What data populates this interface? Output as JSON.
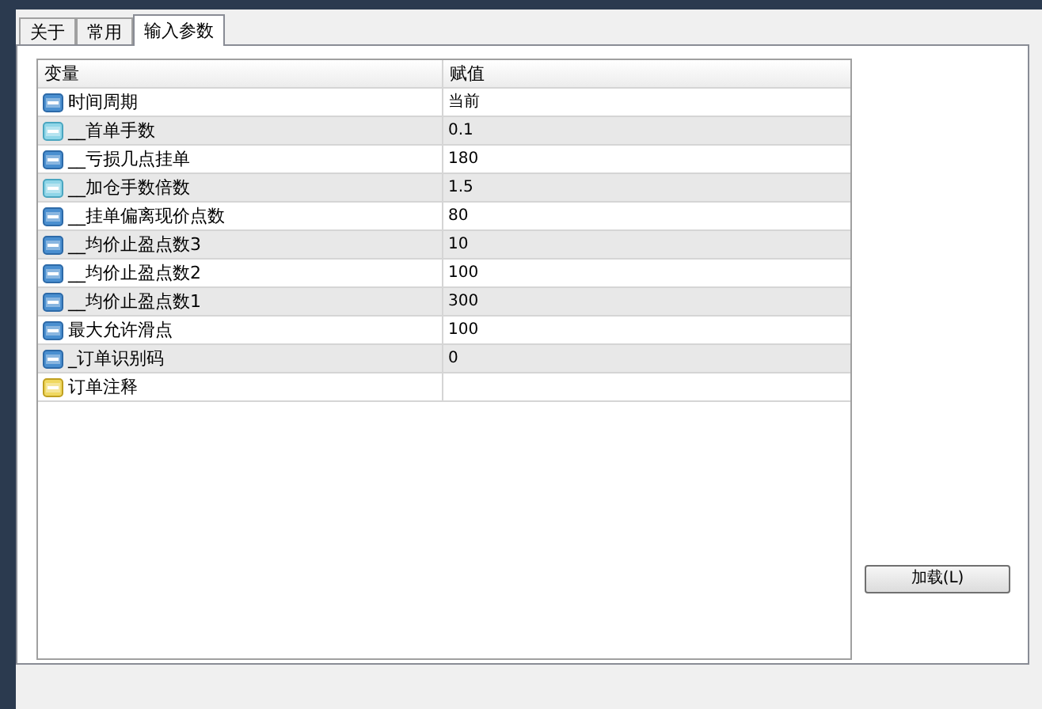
{
  "tabs": [
    {
      "label": "关于",
      "selected": false
    },
    {
      "label": "常用",
      "selected": false
    },
    {
      "label": "输入参数",
      "selected": true
    }
  ],
  "table": {
    "columns": [
      "变量",
      "赋值"
    ],
    "rows": [
      {
        "kind": "int",
        "name": "时间周期",
        "value": "当前"
      },
      {
        "kind": "double",
        "name": "__首单手数",
        "value": "0.1"
      },
      {
        "kind": "int",
        "name": "__亏损几点挂单",
        "value": "180"
      },
      {
        "kind": "double",
        "name": "__加仓手数倍数",
        "value": "1.5"
      },
      {
        "kind": "int",
        "name": "__挂单偏离现价点数",
        "value": "80"
      },
      {
        "kind": "int",
        "name": "__均价止盈点数3",
        "value": "10"
      },
      {
        "kind": "int",
        "name": "__均价止盈点数2",
        "value": "100"
      },
      {
        "kind": "int",
        "name": "__均价止盈点数1",
        "value": "300"
      },
      {
        "kind": "int",
        "name": "最大允许滑点",
        "value": "100"
      },
      {
        "kind": "int",
        "name": "_订单识别码",
        "value": "0"
      },
      {
        "kind": "string",
        "name": "订单注释",
        "value": ""
      }
    ]
  },
  "load_button": "加载(L)"
}
